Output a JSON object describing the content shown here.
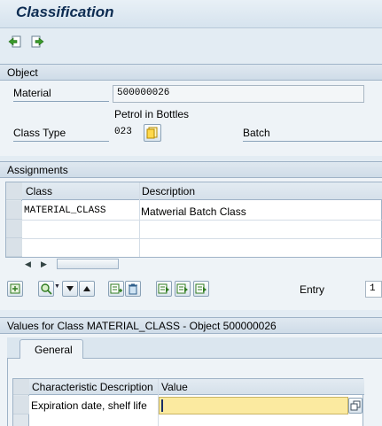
{
  "window": {
    "title": "Classification"
  },
  "toolbar": {
    "icons": [
      "back-document-icon",
      "forward-document-icon"
    ]
  },
  "object_group": {
    "title": "Object",
    "material_label": "Material",
    "material_value": "500000026",
    "material_description": "Petrol in Bottles",
    "class_type_label": "Class Type",
    "class_type_value": "023",
    "class_type_text": "Batch"
  },
  "assignments_group": {
    "title": "Assignments",
    "columns": [
      "Class",
      "Description"
    ],
    "rows": [
      {
        "class": "MATERIAL_CLASS",
        "description": "Matwerial Batch Class"
      }
    ],
    "entry_label": "Entry",
    "entry_value": "1"
  },
  "values_group": {
    "title": "Values for Class MATERIAL_CLASS - Object 500000026",
    "tabs": [
      "General"
    ],
    "columns": [
      "Characteristic Description",
      "Value"
    ],
    "rows": [
      {
        "characteristic": "Expiration date, shelf life",
        "value": ""
      }
    ]
  }
}
